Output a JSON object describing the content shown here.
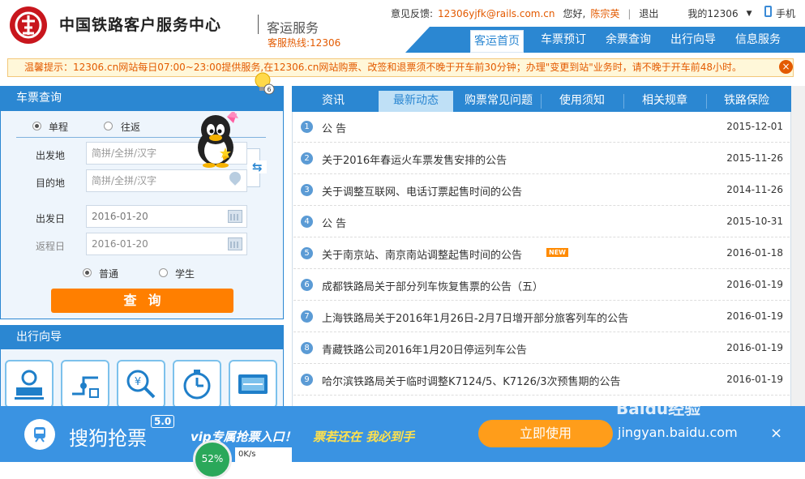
{
  "header": {
    "title": "中国铁路客户服务中心",
    "subtitle": "客运服务",
    "hotline": "客服热线:12306",
    "feedback_label": "意见反馈:",
    "feedback_email": "12306yjfk@rails.com.cn",
    "greeting": "您好,",
    "user_name": "陈宗英",
    "separator": "|",
    "logout": "退出",
    "my_account": "我的12306",
    "mobile": "手机",
    "brand_color": "#c8161d"
  },
  "nav": {
    "items": [
      "客运首页",
      "车票预订",
      "余票查询",
      "出行向导",
      "信息服务"
    ],
    "active_index": 0,
    "color": "#2b87d2"
  },
  "notice": {
    "text": "温馨提示：12306.cn网站每日07:00~23:00提供服务,在12306.cn网站购票、改签和退票须不晚于开车前30分钟；办理\"变更到站\"业务时，请不晚于开车前48小时。",
    "close_label": "×"
  },
  "ticket_query": {
    "title": "车票查询",
    "trip_types": [
      "单程",
      "往返"
    ],
    "trip_type_selected": "单程",
    "from_label": "出发地",
    "from_placeholder": "简拼/全拼/汉字",
    "to_label": "目的地",
    "to_placeholder": "简拼/全拼/汉字",
    "depart_label": "出发日",
    "depart_date": "2016-01-20",
    "return_label": "返程日",
    "return_date": "2016-01-20",
    "passenger_types": [
      "普通",
      "学生"
    ],
    "passenger_type_selected": "普通",
    "search_label": "查询",
    "bulb_count": "6"
  },
  "travel_guide": {
    "title": "出行向导",
    "tiles": [
      "station-icon",
      "route-icon",
      "price-search-icon",
      "time-icon",
      "ticket-icon"
    ]
  },
  "news": {
    "tabs": [
      "资讯",
      "最新动态",
      "购票常见问题",
      "使用须知",
      "相关规章",
      "铁路保险"
    ],
    "active_tab": 1,
    "items": [
      {
        "num": "1",
        "title": "公 告",
        "date": "2015-12-01",
        "badge": ""
      },
      {
        "num": "2",
        "title": "关于2016年春运火车票发售安排的公告",
        "date": "2015-11-26",
        "badge": ""
      },
      {
        "num": "3",
        "title": "关于调整互联网、电话订票起售时间的公告",
        "date": "2014-11-26",
        "badge": ""
      },
      {
        "num": "4",
        "title": "公 告",
        "date": "2015-10-31",
        "badge": ""
      },
      {
        "num": "5",
        "title": "关于南京站、南京南站调整起售时间的公告",
        "date": "2016-01-18",
        "badge": "NEW"
      },
      {
        "num": "6",
        "title": "成都铁路局关于部分列车恢复售票的公告（五）",
        "date": "2016-01-19",
        "badge": ""
      },
      {
        "num": "7",
        "title": "上海铁路局关于2016年1月26日-2月7日增开部分旅客列车的公告",
        "date": "2016-01-19",
        "badge": ""
      },
      {
        "num": "8",
        "title": "青藏铁路公司2016年1月20日停运列车公告",
        "date": "2016-01-19",
        "badge": ""
      },
      {
        "num": "9",
        "title": "哈尔滨铁路局关于临时调整K7124/5、K7126/3次预售期的公告",
        "date": "2016-01-19",
        "badge": ""
      }
    ]
  },
  "banner": {
    "title": "搜狗抢票",
    "version": "5.0",
    "slogan_a": "vip专属抢票入口！",
    "slogan_b": "票若还在 我必到手",
    "cta": "立即使用",
    "close": "×",
    "watermark": "Baidu经验",
    "watermark_url": "jingyan.baidu.com",
    "speed_percent": "52%",
    "speed_value": "0K/s"
  }
}
